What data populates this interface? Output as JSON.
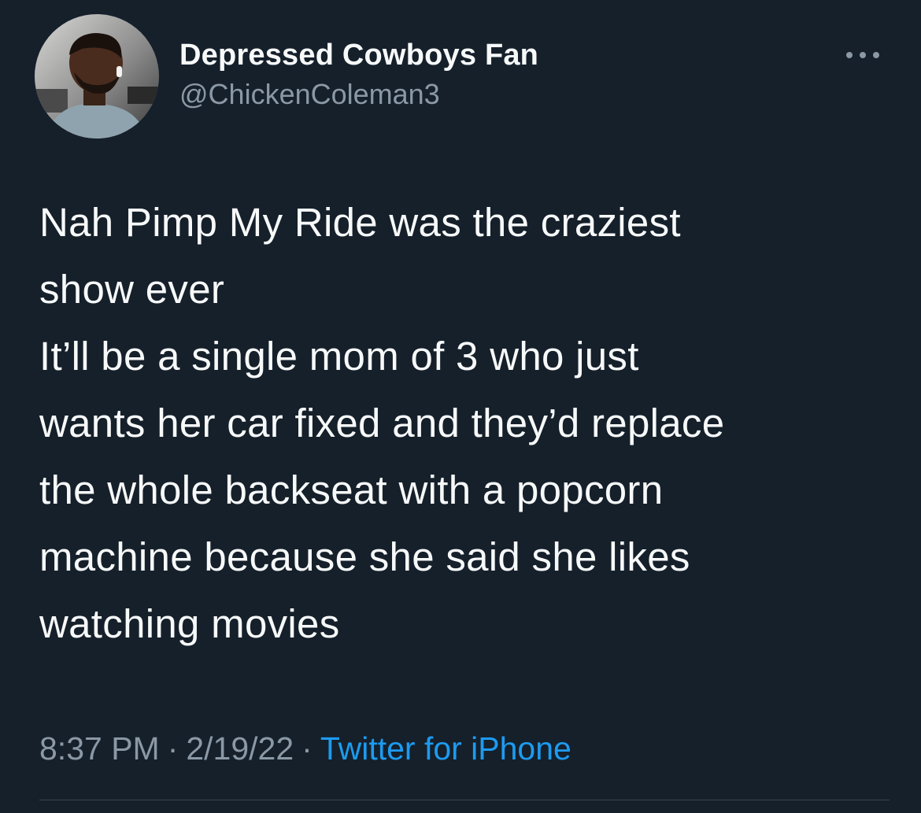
{
  "author": {
    "display_name": "Depressed Cowboys Fan",
    "handle": "@ChickenColeman3"
  },
  "more_icon": "more-horizontal-icon",
  "tweet": {
    "paragraph_1_lines": [
      "Nah Pimp My Ride was the craziest",
      "show ever"
    ],
    "paragraph_2_lines": [
      "It’ll be a single mom of 3 who just",
      "wants her car fixed and they’d replace",
      "the whole backseat with a popcorn",
      "machine because she said she likes",
      "watching movies"
    ]
  },
  "meta": {
    "time": "8:37 PM",
    "separator": "·",
    "date": "2/19/22",
    "source": "Twitter for iPhone"
  },
  "colors": {
    "background": "#15202b",
    "text": "#f7f9f9",
    "secondary_text": "#8b98a5",
    "link": "#1d9bf0"
  }
}
